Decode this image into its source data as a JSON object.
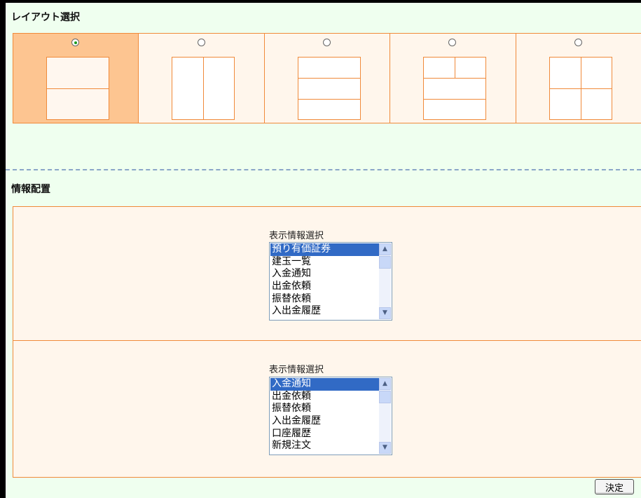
{
  "layout_section": {
    "title": "レイアウト選択",
    "options": [
      {
        "id": "two-rows",
        "selected": true
      },
      {
        "id": "two-columns",
        "selected": false
      },
      {
        "id": "three-rows",
        "selected": false
      },
      {
        "id": "top-split-bottom-rows",
        "selected": false
      },
      {
        "id": "four-grid",
        "selected": false
      }
    ]
  },
  "info_section": {
    "title": "情報配置",
    "panels": [
      {
        "label": "表示情報選択",
        "items": [
          "預り有価証券",
          "建玉一覧",
          "入金通知",
          "出金依頼",
          "振替依頼",
          "入出金履歴"
        ],
        "selected_index": 0
      },
      {
        "label": "表示情報選択",
        "items": [
          "入金通知",
          "出金依頼",
          "振替依頼",
          "入出金履歴",
          "口座履歴",
          "新規注文"
        ],
        "selected_index": 0
      }
    ]
  },
  "scroll_icons": {
    "up": "▲",
    "down": "▼"
  },
  "submit_label": "決定",
  "colors": {
    "accent_orange": "#f08a3a",
    "selected_cell": "#fdc591",
    "page_bg": "#efffef",
    "list_highlight": "#316ac5"
  }
}
